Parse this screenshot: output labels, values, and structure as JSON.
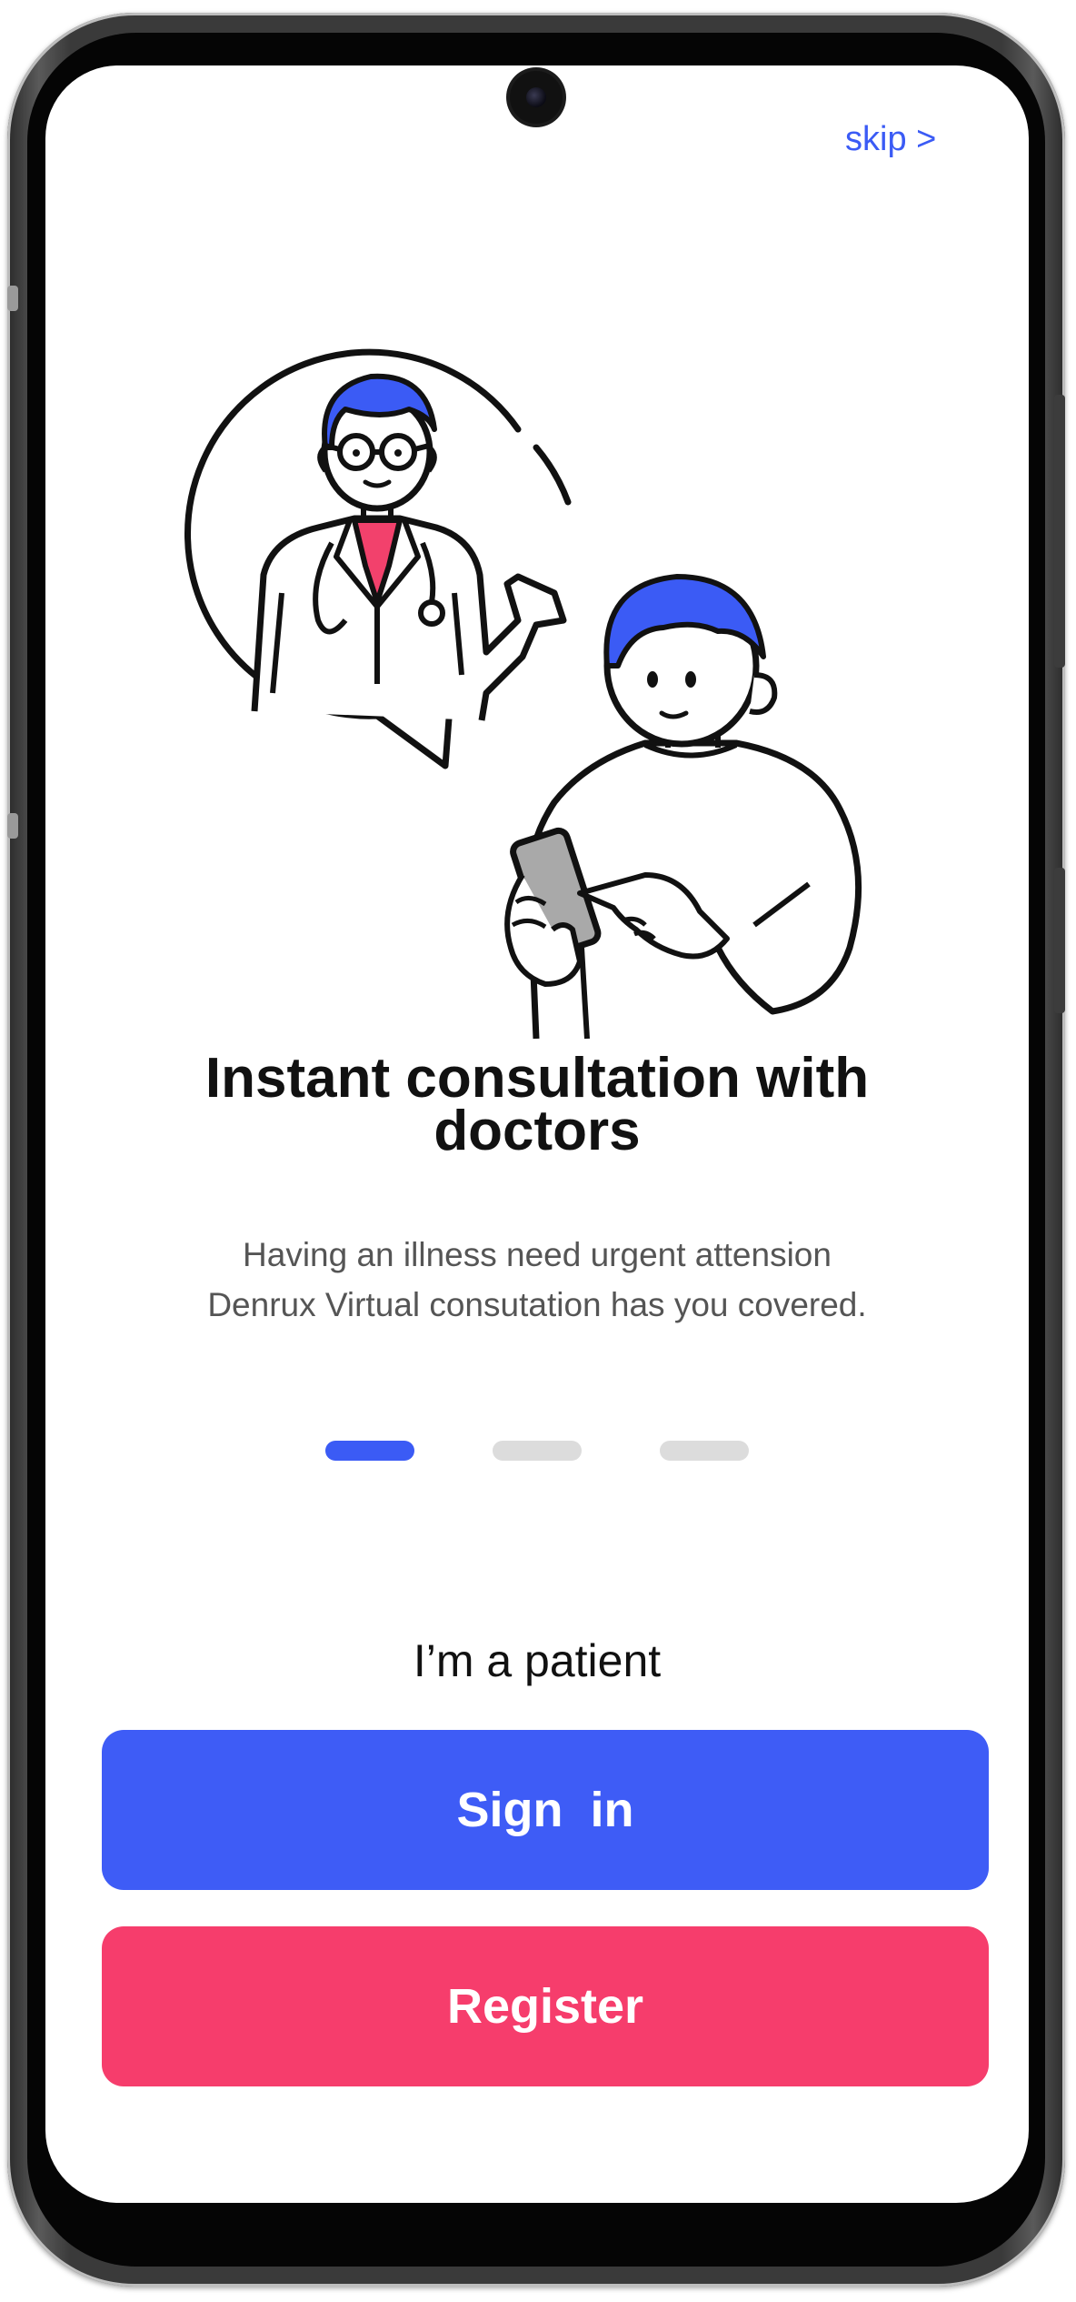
{
  "header": {
    "skip_label": "skip >"
  },
  "onboarding": {
    "title": "Instant consultation with doctors",
    "description": "Having an illness need urgent attension Denrux Virtual consutation has you covered.",
    "page_indicator": {
      "total": 3,
      "active_index": 0
    }
  },
  "auth": {
    "role_label": "I’m a patient",
    "sign_in_label": "Sign  in",
    "register_label": "Register"
  },
  "colors": {
    "accent_blue": "#3e5cf6",
    "accent_pink": "#f63d6c",
    "doctor_shirt": "#f2416c",
    "phone_gray": "#a9a9a9"
  },
  "icons": {
    "illustration": "doctor-patient-video-call-illustration"
  }
}
